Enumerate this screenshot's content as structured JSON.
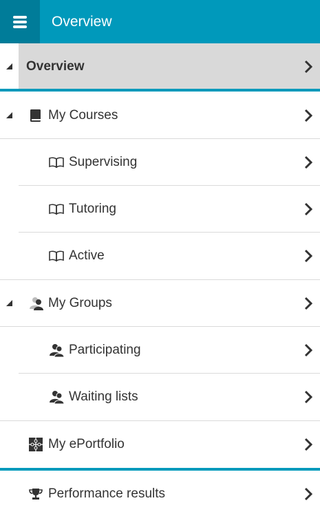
{
  "header": {
    "title": "Overview",
    "menu_icon": "hamburger-menu-icon",
    "background": "#0099bb",
    "menu_background": "#007c99"
  },
  "nav": {
    "overview": {
      "label": "Overview",
      "icon": "chevron-right-icon"
    },
    "items": [
      {
        "label": "My Courses",
        "icon": "book-icon"
      },
      {
        "label": "Supervising",
        "icon": "open-book-icon"
      },
      {
        "label": "Tutoring",
        "icon": "open-book-icon"
      },
      {
        "label": "Active",
        "icon": "open-book-icon"
      },
      {
        "label": "My Groups",
        "icon": "users-icon"
      },
      {
        "label": "Participating",
        "icon": "user-group-icon"
      },
      {
        "label": "Waiting lists",
        "icon": "user-group-icon"
      },
      {
        "label": "My ePortfolio",
        "icon": "puzzle-icon"
      },
      {
        "label": "Performance results",
        "icon": "trophy-icon"
      }
    ]
  },
  "colors": {
    "accent": "#0099bb",
    "selected_row_bg": "#d9d9d9",
    "divider": "#dadada",
    "text": "#333333"
  }
}
